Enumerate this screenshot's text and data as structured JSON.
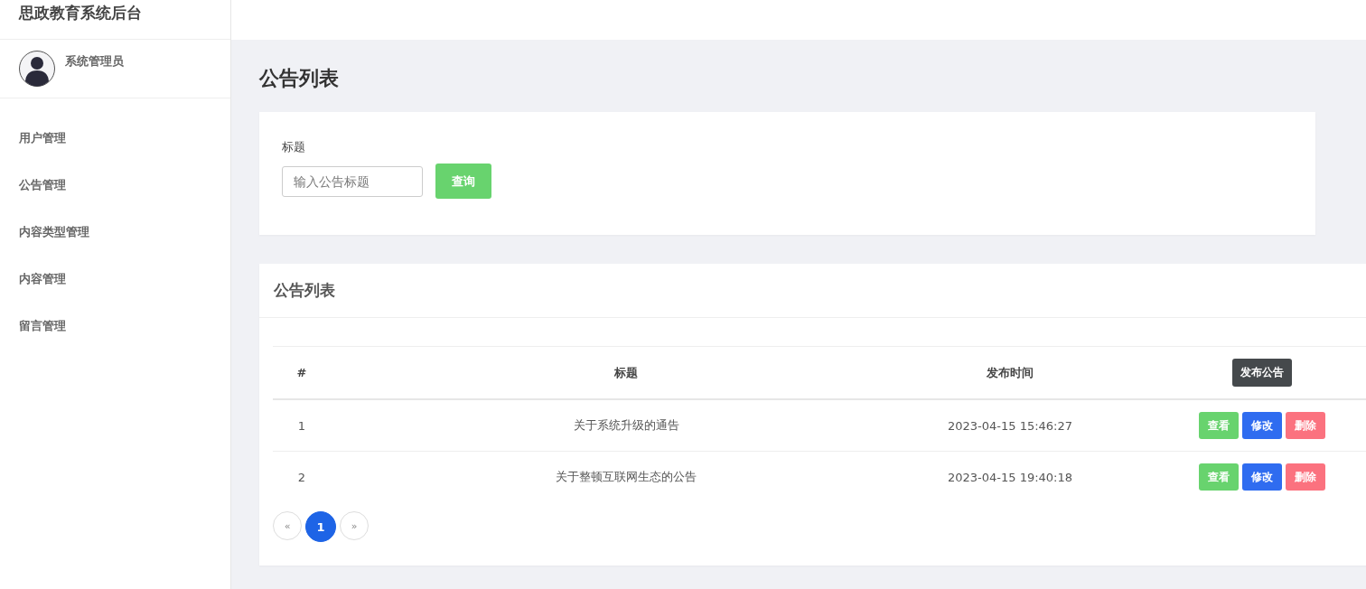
{
  "sidebar": {
    "brand": "思政教育系统后台",
    "user": {
      "name": "系统管理员"
    },
    "items": [
      {
        "label": "用户管理"
      },
      {
        "label": "公告管理"
      },
      {
        "label": "内容类型管理"
      },
      {
        "label": "内容管理"
      },
      {
        "label": "留言管理"
      }
    ]
  },
  "page_title": "公告列表",
  "search": {
    "label": "标题",
    "placeholder": "输入公告标题",
    "button": "查询"
  },
  "table_card": {
    "title": "公告列表",
    "add_button": "发布公告",
    "columns": [
      "#",
      "标题",
      "发布时间"
    ],
    "rows": [
      {
        "cells": [
          "1",
          "关于系统升级的通告",
          "2023-04-15 15:46:27"
        ],
        "actions": [
          {
            "kind": "view",
            "label": "查看"
          },
          {
            "kind": "edit",
            "label": "修改"
          },
          {
            "kind": "delete",
            "label": "删除"
          }
        ]
      },
      {
        "cells": [
          "2",
          "关于整顿互联网生态的公告",
          "2023-04-15 19:40:18"
        ],
        "actions": [
          {
            "kind": "view",
            "label": "查看"
          },
          {
            "kind": "edit",
            "label": "修改"
          },
          {
            "kind": "delete",
            "label": "删除"
          }
        ]
      }
    ],
    "pagination": [
      {
        "label": "«",
        "selected": false
      },
      {
        "label": "1",
        "selected": true
      },
      {
        "label": "»",
        "selected": false
      }
    ]
  }
}
